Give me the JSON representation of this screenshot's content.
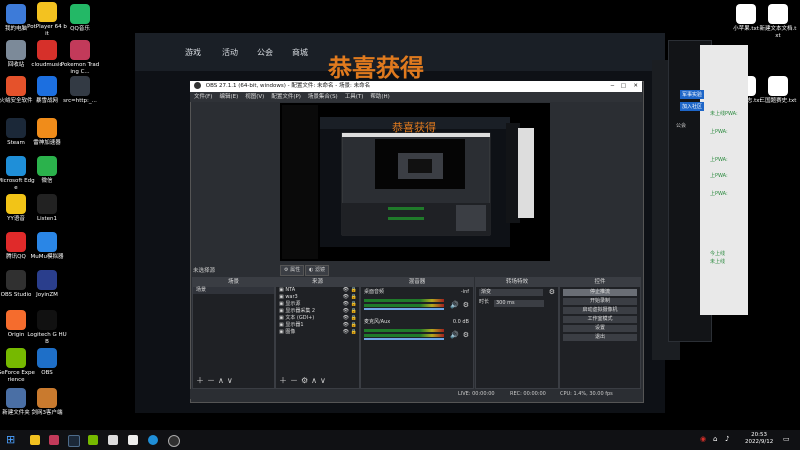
{
  "desktop_left": [
    {
      "name": "desktop-icon-this-pc",
      "label": "我的电脑",
      "icon": "monitor",
      "color": "#3d7bd9"
    },
    {
      "name": "desktop-icon-potplayer",
      "label": "PotPlayer 64 bit",
      "icon": "play",
      "color": "#f3c220"
    },
    {
      "name": "desktop-icon-qq-music",
      "label": "QQ音乐",
      "icon": "music",
      "color": "#23b866"
    },
    {
      "name": "desktop-icon-recycle-bin",
      "label": "回收站",
      "icon": "trash",
      "color": "#7c8a99"
    },
    {
      "name": "desktop-icon-cloudmusic",
      "label": "cloudmusic",
      "icon": "netease",
      "color": "#d6302a"
    },
    {
      "name": "desktop-icon-pokemon",
      "label": "Pokemon Trading C...",
      "icon": "pokeball",
      "color": "#c23a5a"
    },
    {
      "name": "desktop-icon-huorong",
      "label": "火绒安全软件",
      "icon": "shield",
      "color": "#e5522b"
    },
    {
      "name": "desktop-icon-baofeng",
      "label": "暴雪战网",
      "icon": "battlenet",
      "color": "#1c6fe0"
    },
    {
      "name": "desktop-icon-src",
      "label": "src=http:_...",
      "icon": "image",
      "color": "#333a44"
    },
    {
      "name": "desktop-icon-steam",
      "label": "Steam",
      "icon": "steam",
      "color": "#1b2838"
    },
    {
      "name": "desktop-icon-leishen",
      "label": "雷神加速器",
      "icon": "leishen",
      "color": "#f08c1a"
    },
    {
      "name": "desktop-icon-edge",
      "label": "Microsoft Edge",
      "icon": "edge",
      "color": "#1f8fd8"
    },
    {
      "name": "desktop-icon-wechat",
      "label": "微信",
      "icon": "wechat",
      "color": "#2bb24c"
    },
    {
      "name": "desktop-icon-yy",
      "label": "YY语音",
      "icon": "yy",
      "color": "#f2c417"
    },
    {
      "name": "desktop-icon-listen1",
      "label": "Listen1",
      "icon": "listen1",
      "color": "#222222"
    },
    {
      "name": "desktop-icon-tencent-qq",
      "label": "腾讯QQ",
      "icon": "qq",
      "color": "#e02a2a"
    },
    {
      "name": "desktop-icon-mumu",
      "label": "MuMu模拟器",
      "icon": "mumu",
      "color": "#2a86e6"
    },
    {
      "name": "desktop-icon-obs-studio",
      "label": "OBS Studio",
      "icon": "obs",
      "color": "#303030"
    },
    {
      "name": "desktop-icon-joyinzm",
      "label": "JoyinZM",
      "icon": "joy",
      "color": "#2a3e8c"
    },
    {
      "name": "desktop-icon-origin",
      "label": "Origin",
      "icon": "origin",
      "color": "#f56c2d"
    },
    {
      "name": "desktop-icon-logitech",
      "label": "Logitech G HUB",
      "icon": "logitech",
      "color": "#111111"
    },
    {
      "name": "desktop-icon-geforce",
      "label": "GeForce Experience",
      "icon": "nvidia",
      "color": "#76b900"
    },
    {
      "name": "desktop-icon-obs",
      "label": "OBS",
      "icon": "gear",
      "color": "#1e6fc8"
    },
    {
      "name": "desktop-icon-new-file",
      "label": "新建文件夹",
      "icon": "doc",
      "color": "#4a6fa5"
    },
    {
      "name": "desktop-icon-sword",
      "label": "剑网3客户端",
      "icon": "sword",
      "color": "#c97a2e"
    }
  ],
  "desktop_right": [
    {
      "name": "desktop-icon-xiaomi",
      "label": "小苹果.txt",
      "icon": "txt",
      "color": "#ffffff"
    },
    {
      "name": "desktop-icon-new-text",
      "label": "新建文本文档.txt",
      "icon": "txt",
      "color": "#ffffff"
    },
    {
      "name": "desktop-icon-sanguo",
      "label": "三国意志.txt",
      "icon": "txt",
      "color": "#ffffff"
    },
    {
      "name": "desktop-icon-sanguo2",
      "label": "三国题赛史.txt",
      "icon": "txt",
      "color": "#ffffff"
    }
  ],
  "game": {
    "tabs": [
      "游戏",
      "活动",
      "公会",
      "商城"
    ],
    "banner": "恭喜获得",
    "side_lines": [
      "军事实验",
      "加入社区",
      "公会"
    ]
  },
  "right_panel": {
    "lines": [
      "未上线PWA:",
      "上PWA:",
      "上PWA:",
      "上PWA:",
      "上PWA:",
      "今上线",
      "未上线"
    ]
  },
  "obs": {
    "title": "OBS 27.1.1 (64-bit, windows) - 配置文件: 未命名 - 场景: 未命名",
    "menu": [
      "文件(F)",
      "编辑(E)",
      "视图(V)",
      "配置文件(P)",
      "场景集合(S)",
      "工具(T)",
      "帮助(H)"
    ],
    "scene_label": "未选择源",
    "toolbar": {
      "props": "属性",
      "filters": "滤镜"
    },
    "panels": {
      "scenes": {
        "title": "场景",
        "items": [
          "场景"
        ]
      },
      "sources": {
        "title": "来源",
        "items": [
          "NTA",
          "war3",
          "显示源",
          "显示器采集 2",
          "文本 (GDI+)",
          "显示器1",
          "图像"
        ]
      },
      "mixer": {
        "title": "混音器",
        "channels": [
          {
            "name": "桌面音频",
            "level": "-inf"
          },
          {
            "name": "麦克风/Aux",
            "level": "0.0 dB"
          }
        ]
      },
      "transitions": {
        "title": "转场特效",
        "select": "渐变",
        "duration_label": "时长",
        "duration": "300 ms"
      },
      "controls": {
        "title": "控件",
        "buttons": [
          "停止推流",
          "开始录制",
          "启动虚拟摄像机",
          "工作室模式",
          "设置",
          "退出"
        ]
      }
    },
    "status": {
      "live": "LIVE: 00:00:00",
      "rec": "REC: 00:00:00",
      "cpu": "CPU: 1.4%, 30.00 fps"
    }
  },
  "taskbar": {
    "time": "20:53",
    "date": "2022/9/12"
  }
}
